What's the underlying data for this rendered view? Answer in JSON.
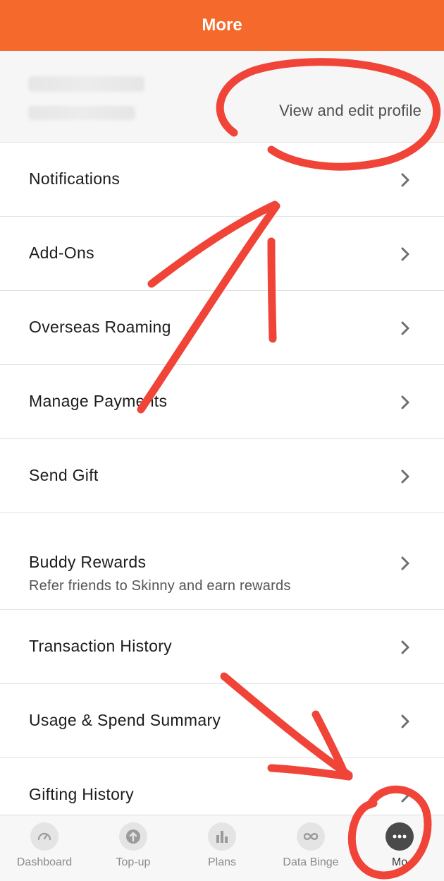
{
  "header": {
    "title": "More"
  },
  "profile": {
    "link_label": "View and edit profile"
  },
  "menu": {
    "items": [
      {
        "label": "Notifications"
      },
      {
        "label": "Add-Ons"
      },
      {
        "label": "Overseas Roaming"
      },
      {
        "label": "Manage Payments"
      },
      {
        "label": "Send Gift"
      },
      {
        "label": "Buddy Rewards",
        "subtitle": "Refer friends to Skinny and earn rewards"
      },
      {
        "label": "Transaction History"
      },
      {
        "label": "Usage & Spend Summary"
      },
      {
        "label": "Gifting History"
      }
    ]
  },
  "tabbar": {
    "tabs": [
      {
        "label": "Dashboard",
        "icon": "speedometer-icon"
      },
      {
        "label": "Top-up",
        "icon": "arrow-up-icon"
      },
      {
        "label": "Plans",
        "icon": "bar-chart-icon"
      },
      {
        "label": "Data Binge",
        "icon": "infinity-icon"
      },
      {
        "label": "Mo",
        "icon": "more-dots-icon"
      }
    ]
  },
  "colors": {
    "header_bg": "#f5692c",
    "annotation_red": "#f04438",
    "active_tab": "#4a4a4a"
  }
}
